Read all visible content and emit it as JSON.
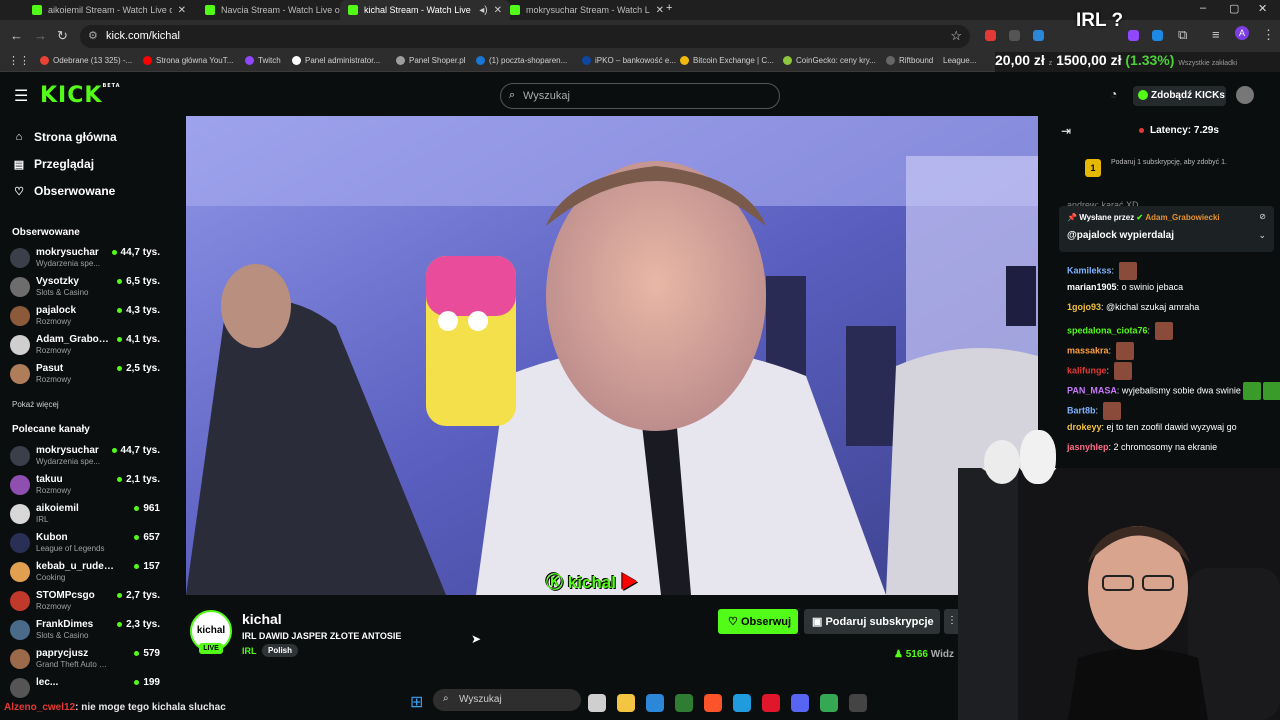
{
  "browser": {
    "tabs": [
      {
        "title": "aikoiemil Stream - Watch Live o",
        "active": false
      },
      {
        "title": "Navcia Stream - Watch Live on",
        "active": false
      },
      {
        "title": "kichal Stream - Watch Live",
        "active": true
      },
      {
        "title": "mokrysuchar Stream - Watch Li",
        "active": false
      }
    ],
    "url": "kick.com/kichal",
    "bookmarks": [
      {
        "label": "Odebrane (13 325) -...",
        "color": "#ea4335"
      },
      {
        "label": "Strona główna YouT...",
        "color": "#ff0000"
      },
      {
        "label": "Twitch",
        "color": "#9146ff"
      },
      {
        "label": "Panel administrator...",
        "color": "#ffffff"
      },
      {
        "label": "Panel Shoper.pl",
        "color": "#9e9e9e"
      },
      {
        "label": "(1) poczta-shoparen...",
        "color": "#1976d2"
      },
      {
        "label": "iPKO – bankowość e...",
        "color": "#0d47a1"
      },
      {
        "label": "Bitcoin Exchange | C...",
        "color": "#f0b90b"
      },
      {
        "label": "CoinGecko: ceny kry...",
        "color": "#8dc63f"
      },
      {
        "label": "Riftbound",
        "color": "#666666"
      },
      {
        "label": "League...",
        "color": "#888888"
      }
    ]
  },
  "overlay": {
    "irl_label": "IRL ?",
    "ticker_a": "20,00 zł",
    "ticker_mid": "z",
    "ticker_b": "1500,00 zł",
    "ticker_pct": "(1.33%)",
    "ticker_tail": "Wszystkie zakładki"
  },
  "kick": {
    "logo": "KICK",
    "logo_beta": "BETA",
    "search_placeholder": "Wyszukaj",
    "get_kicks": "Zdobądź KICKs",
    "nav": [
      {
        "label": "Strona główna",
        "icon": "home-icon",
        "glyph": "⌂"
      },
      {
        "label": "Przeglądaj",
        "icon": "browse-icon",
        "glyph": "▤"
      },
      {
        "label": "Obserwowane",
        "icon": "heart-icon",
        "glyph": "♡"
      }
    ],
    "followed_heading": "Obserwowane",
    "followed": [
      {
        "name": "mokrysuchar",
        "category": "Wydarzenia spe...",
        "viewers": "44,7 tys.",
        "color": "#3a3f4a"
      },
      {
        "name": "Vysotzky",
        "category": "Slots & Casino",
        "viewers": "6,5 tys.",
        "color": "#6d6d6d"
      },
      {
        "name": "pajalock",
        "category": "Rozmowy",
        "viewers": "4,3 tys.",
        "color": "#8a5a3a"
      },
      {
        "name": "Adam_Grabowi...",
        "category": "Rozmowy",
        "viewers": "4,1 tys.",
        "color": "#cfcfcf"
      },
      {
        "name": "Pasut",
        "category": "Rozmowy",
        "viewers": "2,5 tys.",
        "color": "#b07d5a"
      }
    ],
    "show_more": "Pokaż więcej",
    "recommended_heading": "Polecane kanały",
    "recommended": [
      {
        "name": "mokrysuchar",
        "category": "Wydarzenia spe...",
        "viewers": "44,7 tys.",
        "color": "#3a3f4a"
      },
      {
        "name": "takuu",
        "category": "Rozmowy",
        "viewers": "2,1 tys.",
        "color": "#8e4fb0"
      },
      {
        "name": "aikoiemil",
        "category": "IRL",
        "viewers": "961",
        "color": "#d8d8d8"
      },
      {
        "name": "Kubon",
        "category": "League of Legends",
        "viewers": "657",
        "color": "#2a2f55"
      },
      {
        "name": "kebab_u_rudego",
        "category": "Cooking",
        "viewers": "157",
        "color": "#e0a050"
      },
      {
        "name": "STOMPcsgo",
        "category": "Rozmowy",
        "viewers": "2,7 tys.",
        "color": "#c0392b"
      },
      {
        "name": "FrankDimes",
        "category": "Slots & Casino",
        "viewers": "2,3 tys.",
        "color": "#4a6a8a"
      },
      {
        "name": "paprycjusz",
        "category": "Grand Theft Auto V (G...",
        "viewers": "579",
        "color": "#9a6a4a"
      },
      {
        "name": "lec...",
        "category": "",
        "viewers": "199",
        "color": "#555555"
      }
    ]
  },
  "stream": {
    "watermark": "kichal",
    "channel": "kichal",
    "avatar_text": "kichal",
    "live": "LIVE",
    "title": "IRL DAWID JASPER ZŁOTE ANTOSIE",
    "category": "IRL",
    "tag": "Polish",
    "follow_label": "Obserwuj",
    "gift_label": "Podaruj subskrypcje",
    "viewers": "5166",
    "viewers_label": "Widz"
  },
  "chat": {
    "latency": "Latency: 7.29s",
    "gift_goal": "Podaruj 1 subskrypcję, aby zdobyć 1.",
    "gift_count": "1",
    "pinned_by_prefix": "Wysłane przez",
    "pinned_by": "Adam_Grabowiecki",
    "pinned_msg": "@pajalock wypierdalaj",
    "partial_top": "andrew: karać XD",
    "messages": [
      {
        "user": "Kamilekss",
        "color": "#7fb3ff",
        "text": "",
        "emotes": 1,
        "green": false
      },
      {
        "user": "marian1905",
        "color": "#ffffff",
        "text": "o swinio jebaca",
        "emotes": 0,
        "green": false
      },
      {
        "user": "1gojo93",
        "color": "#f0c040",
        "text": "@kichal szukaj amraha",
        "emotes": 0,
        "green": false
      },
      {
        "user": "spedalona_ciota76",
        "color": "#53fc18",
        "text": "",
        "emotes": 1,
        "green": false
      },
      {
        "user": "massakra",
        "color": "#ff9f40",
        "text": "",
        "emotes": 1,
        "green": false
      },
      {
        "user": "kalifunge",
        "color": "#e53935",
        "text": "",
        "emotes": 1,
        "green": false
      },
      {
        "user": "PAN_MASA",
        "color": "#c678ff",
        "text": "wyjebalismy sobie dwa swinie",
        "emotes": 2,
        "green": true
      },
      {
        "user": "Bart8b",
        "color": "#7fb3ff",
        "text": "",
        "emotes": 1,
        "green": false
      },
      {
        "user": "drokeyy",
        "color": "#f0c040",
        "text": "ej to ten zoofil dawid wyzywaj go",
        "emotes": 0,
        "green": false
      },
      {
        "user": "jasnyhlep",
        "color": "#ff6b8a",
        "text": "2 chromosomy na ekranie",
        "emotes": 0,
        "green": false
      }
    ]
  },
  "bottom_chat": {
    "user": "Alzeno_cwel12",
    "text": ": nie moge tego kichala sluchac"
  },
  "taskbar": {
    "search": "Wyszukaj",
    "apps": [
      {
        "name": "taskview-icon",
        "color": "#cfcfcf"
      },
      {
        "name": "explorer-icon",
        "color": "#f4c542"
      },
      {
        "name": "store-icon",
        "color": "#2b88d8"
      },
      {
        "name": "app-icon",
        "color": "#2e7d32"
      },
      {
        "name": "brave-icon",
        "color": "#fb542b"
      },
      {
        "name": "edge-icon",
        "color": "#1f9bde"
      },
      {
        "name": "opera-icon",
        "color": "#e0162b"
      },
      {
        "name": "discord-icon",
        "color": "#5865f2"
      },
      {
        "name": "chrome-icon",
        "color": "#34a853"
      },
      {
        "name": "obs-icon",
        "color": "#444444"
      }
    ]
  }
}
